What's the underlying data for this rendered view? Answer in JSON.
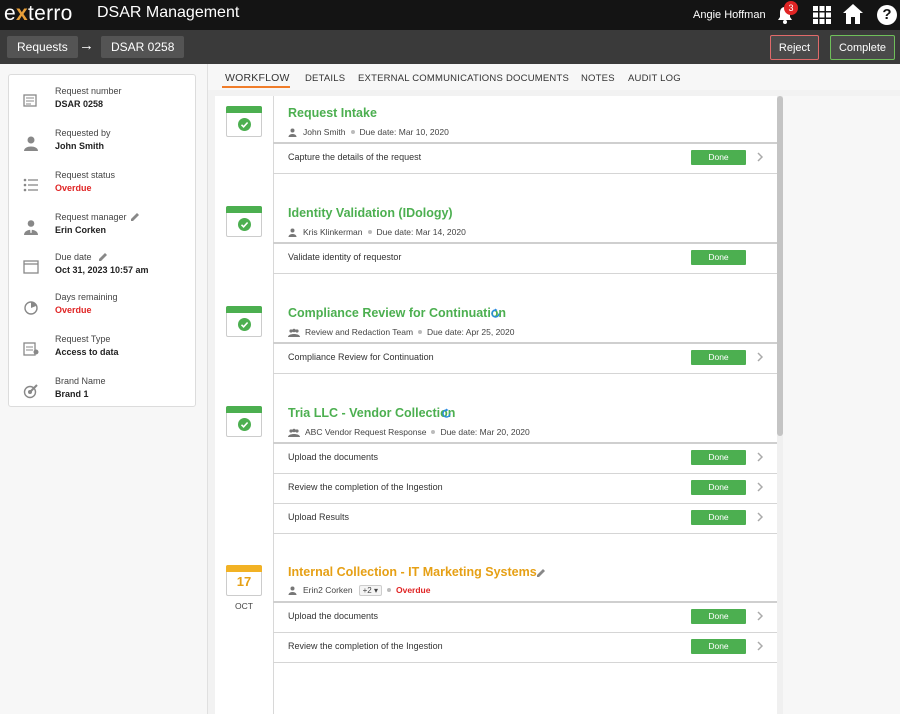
{
  "app": {
    "logo_e": "e",
    "logo_x": "x",
    "logo_rest": "terro",
    "title": "DSAR Management",
    "user_name": "Angie Hoffman",
    "notification_count": "3"
  },
  "breadcrumb": {
    "item_1": "Requests",
    "arrow": "→",
    "item_2": "DSAR 0258"
  },
  "actions": {
    "reject_label": "Reject",
    "complete_label": "Complete"
  },
  "request_info": [
    {
      "label": "Request number",
      "value": "DSAR 0258",
      "icon": "document-list-icon"
    },
    {
      "label": "Requested by",
      "value": "John Smith",
      "icon": "person-icon"
    },
    {
      "label": "Request status",
      "value": "Overdue",
      "icon": "list-icon"
    },
    {
      "label": "Request manager",
      "value": "Erin Corken",
      "icon": "manager-icon"
    },
    {
      "label": "Due date",
      "value": "Oct 31, 2023 10:57 am",
      "icon": "calendar-icon"
    },
    {
      "label": "Days remaining",
      "value": "Overdue",
      "icon": "timer-icon"
    },
    {
      "label": "Request Type",
      "value": "Access to data",
      "icon": "request-type-icon"
    },
    {
      "label": "Brand Name",
      "value": "Brand 1",
      "icon": "brand-icon"
    }
  ],
  "tabs": [
    "WORKFLOW",
    "DETAILS",
    "EXTERNAL COMMUNICATIONS",
    "DOCUMENTS",
    "NOTES",
    "AUDIT LOG"
  ],
  "help_label": "?",
  "steps": [
    {
      "title": "Request Intake",
      "assignee": "John Smith",
      "due": "Due date: Mar 10, 2020",
      "tasks": [
        {
          "label": "Capture the details of the request",
          "status": "Done"
        }
      ]
    },
    {
      "title": "Identity Validation (IDology)",
      "assignee": "Kris Klinkerman",
      "due": "Due date: Mar 14, 2020",
      "tasks": [
        {
          "label": "Validate identity of requestor",
          "status": "Done"
        }
      ]
    },
    {
      "title": "Compliance Review for Continuation",
      "assignee": "Review and Redaction Team",
      "due": "Due date: Apr 25, 2020",
      "tasks": [
        {
          "label": "Compliance Review for Continuation",
          "status": "Done"
        }
      ]
    },
    {
      "title": "Tria LLC - Vendor Collection",
      "assignee": "ABC Vendor Request Response",
      "due": "Due date: Mar 20, 2020",
      "tasks": [
        {
          "label": "Upload the documents",
          "status": "Done"
        },
        {
          "label": "Review the completion of the Ingestion",
          "status": "Done"
        },
        {
          "label": "Upload Results",
          "status": "Done"
        }
      ]
    },
    {
      "title": "Internal Collection - IT Marketing Systems",
      "assignee": "Erin2 Corken",
      "extra_assignees": "+2",
      "due": "Overdue",
      "calendar_day": "17",
      "calendar_month": "OCT",
      "tasks": [
        {
          "label": "Upload the documents",
          "status": "Done"
        },
        {
          "label": "Review the completion of the Ingestion",
          "status": "Done"
        }
      ]
    }
  ],
  "colors": {
    "accent_green": "#4caf50",
    "accent_orange": "#e6a015",
    "overdue_red": "#e02424",
    "tab_underline": "#f07d2a"
  }
}
